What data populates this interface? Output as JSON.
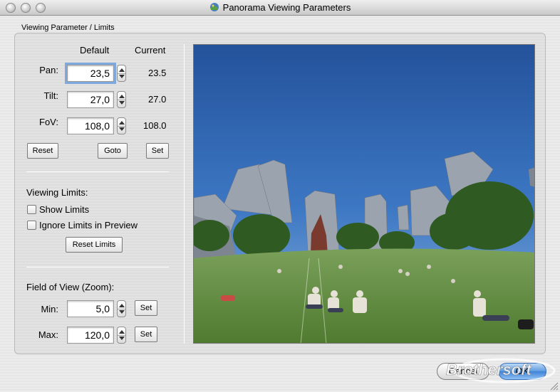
{
  "window": {
    "title": "Panorama Viewing Parameters"
  },
  "group": {
    "label": "Viewing Parameter / Limits"
  },
  "params": {
    "header_default": "Default",
    "header_current": "Current",
    "pan": {
      "label": "Pan:",
      "default": "23,5",
      "current": "23.5"
    },
    "tilt": {
      "label": "Tilt:",
      "default": "27,0",
      "current": "27.0"
    },
    "fov": {
      "label": "FoV:",
      "default": "108,0",
      "current": "108.0"
    },
    "buttons": {
      "reset": "Reset",
      "goto": "Goto",
      "set": "Set"
    }
  },
  "limits": {
    "heading": "Viewing Limits:",
    "show_limits": "Show Limits",
    "ignore_limits": "Ignore Limits in Preview",
    "reset_button": "Reset Limits"
  },
  "zoom": {
    "heading": "Field of View (Zoom):",
    "min": {
      "label": "Min:",
      "value": "5,0",
      "set": "Set"
    },
    "max": {
      "label": "Max:",
      "value": "120,0",
      "set": "Set"
    }
  },
  "footer": {
    "cancel": "Cancel",
    "ok": "OK"
  },
  "watermark": {
    "text": "Brothersoft"
  },
  "colors": {
    "accent": "#3e82d6",
    "focus": "#7fa8dd",
    "sky": "#2f64ad",
    "grass": "#5f8a3c"
  }
}
